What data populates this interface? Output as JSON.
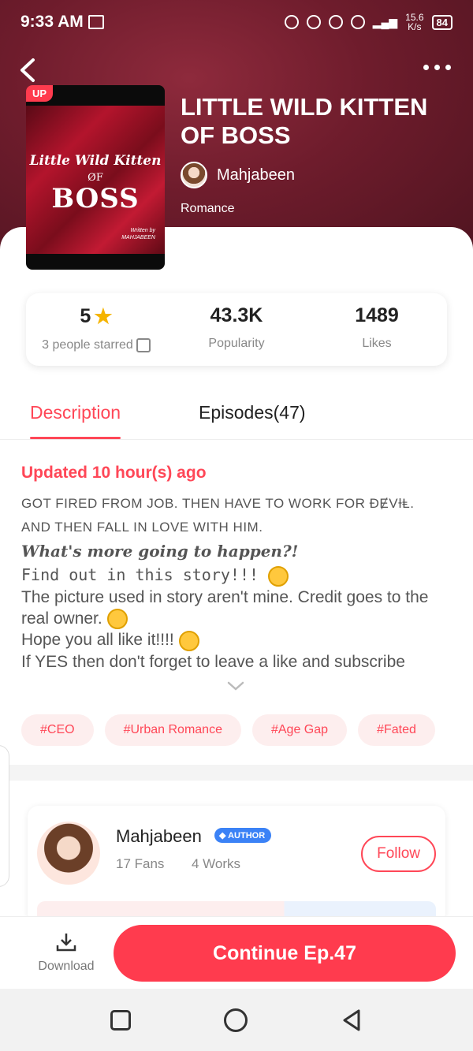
{
  "status_bar": {
    "time": "9:33 AM",
    "speed": "15.6",
    "speed_unit": "K/s",
    "battery": "84"
  },
  "header": {
    "title": "LITTLE WILD KITTEN OF BOSS",
    "author": "Mahjabeen",
    "genre": "Romance",
    "cover": {
      "badge": "UP",
      "line1": "Little Wild Kitten",
      "line2": "ØF",
      "line3": "BOSS",
      "byline": "Written by",
      "byname": "MAHJABEEN"
    }
  },
  "stats": {
    "rating": "5",
    "rating_label": "3 people starred",
    "popularity": "43.3K",
    "popularity_label": "Popularity",
    "likes": "1489",
    "likes_label": "Likes"
  },
  "tabs": {
    "description": "Description",
    "episodes": "Episodes(47)"
  },
  "description": {
    "updated": "Updated 10 hour(s) ago",
    "line1": "GOT FIRED FROM JOB. THEN HAVE TO WORK FOR ĐɆVɨⱠ.",
    "line2": "AND THEN FALL IN LOVE WITH HIM.",
    "line3": "What's more going to happen?!",
    "line4": "Find out in this story!!!",
    "line5": "The picture used in story aren't mine. Credit goes to the real owner.",
    "line6": "Hope you all like it!!!!",
    "line7": "If YES then don't forget to leave a like and subscribe"
  },
  "tags": [
    "#CEO",
    "#Urban Romance",
    "#Age Gap",
    "#Fated"
  ],
  "author_card": {
    "name": "Mahjabeen",
    "badge": "AUTHOR",
    "fans": "17 Fans",
    "works": "4 Works",
    "follow": "Follow"
  },
  "bottom_bar": {
    "download": "Download",
    "continue": "Continue Ep.47"
  },
  "colors": {
    "accent": "#ff4757",
    "hero_dark": "#4f1420",
    "hero_light": "#8e2a3c",
    "star": "#f5b400",
    "badge_blue": "#3b82f6"
  },
  "icons": [
    "back-arrow-icon",
    "more-dots-icon",
    "star-icon",
    "edit-icon",
    "chevron-down-icon",
    "download-icon",
    "nav-square-icon",
    "nav-circle-icon",
    "nav-back-icon",
    "emoji-grin-icon",
    "emoji-smile-icon"
  ]
}
